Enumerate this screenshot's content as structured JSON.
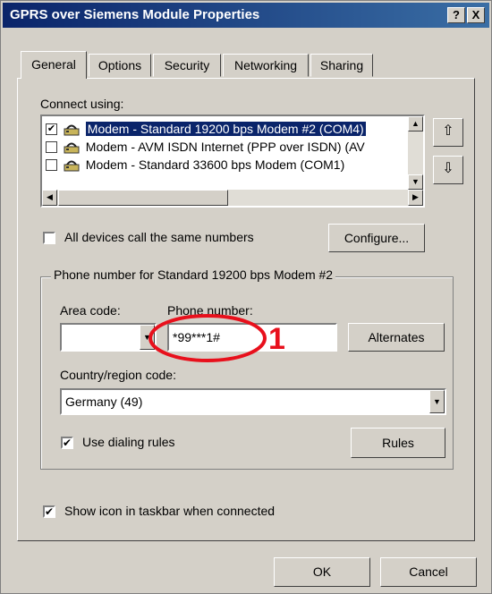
{
  "window": {
    "title": "GPRS over Siemens Module Properties",
    "help_label": "?",
    "close_label": "X"
  },
  "tabs": [
    {
      "label": "General",
      "active": true
    },
    {
      "label": "Options"
    },
    {
      "label": "Security"
    },
    {
      "label": "Networking"
    },
    {
      "label": "Sharing"
    }
  ],
  "connect_using": {
    "label": "Connect using:",
    "devices": [
      {
        "label": "Modem - Standard 19200 bps Modem #2 (COM4)",
        "checked": true,
        "selected": true
      },
      {
        "label": "Modem - AVM ISDN Internet (PPP over ISDN) (AV",
        "checked": false
      },
      {
        "label": "Modem - Standard 33600 bps Modem (COM1)",
        "checked": false
      }
    ],
    "move_up_icon": "up-arrow-icon",
    "move_down_icon": "down-arrow-icon"
  },
  "all_devices": {
    "label": "All devices call the same numbers",
    "checked": false
  },
  "configure_label": "Configure...",
  "phone_group": {
    "title": "Phone number for Standard 19200 bps Modem #2",
    "area_code_label": "Area code:",
    "area_code_value": "",
    "phone_number_label": "Phone number:",
    "phone_number_value": "*99***1#",
    "alternates_label": "Alternates",
    "country_label": "Country/region code:",
    "country_value": "Germany (49)",
    "dialing_rules": {
      "label": "Use dialing rules",
      "checked": true
    },
    "rules_label": "Rules"
  },
  "show_icon": {
    "label": "Show icon in taskbar when connected",
    "checked": true
  },
  "annotation": {
    "number": "1",
    "color": "#e8101c"
  },
  "ok_label": "OK",
  "cancel_label": "Cancel",
  "colors": {
    "titlebar": "#0a246a",
    "dialog": "#d4d0c8"
  }
}
